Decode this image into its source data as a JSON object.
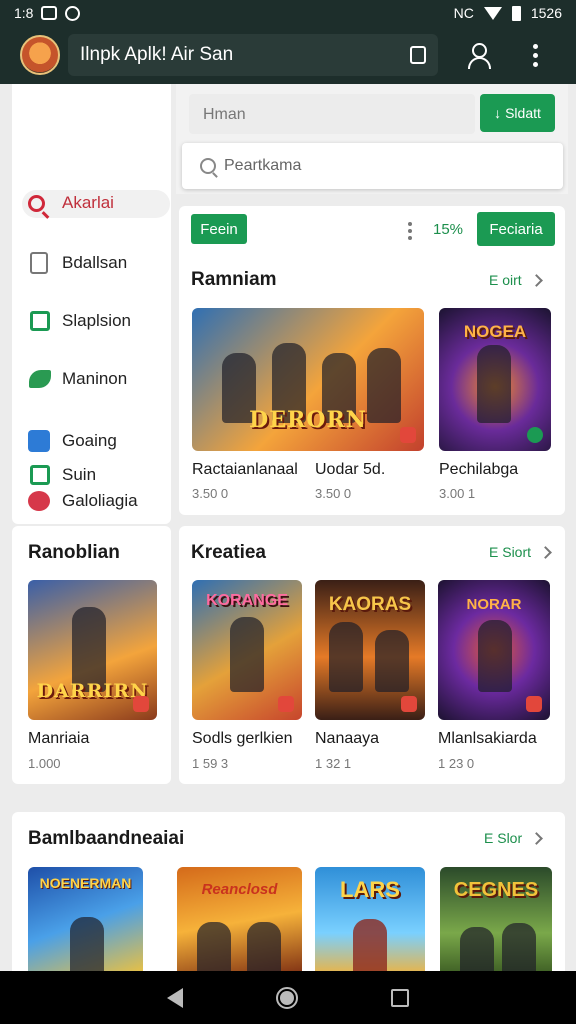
{
  "status_bar": {
    "time_left": "1:8",
    "time_right": "1526",
    "network": "NC"
  },
  "app_bar": {
    "title": "Ilnpk Aplk! Air San"
  },
  "sidebar": {
    "items": [
      {
        "label": "Akarlai",
        "icon": "search-icon",
        "active": true,
        "color": "#d0283a"
      },
      {
        "label": "Bdallsan",
        "icon": "document-icon",
        "color": "#777777"
      },
      {
        "label": "Slaplsion",
        "icon": "bag-icon",
        "color": "#1b9a53"
      },
      {
        "label": "Maninon",
        "icon": "leaf-icon",
        "color": "#2a9a52"
      },
      {
        "label": "Goaing",
        "icon": "check-icon",
        "color": "#2d7bd6"
      },
      {
        "label": "Galoliagia",
        "icon": "tag-icon",
        "color": "#d6384a"
      },
      {
        "label": "Suin",
        "icon": "play-icon",
        "color": "#1b9a53"
      }
    ]
  },
  "search": {
    "placeholder": "Hman",
    "filter_label": "Sldatt",
    "suggestion": "Peartkama"
  },
  "featured": {
    "chip": "Feein",
    "percent": "15%",
    "button": "Feciaria",
    "title": "Ramniam",
    "see_all": "E oirt",
    "cards": [
      {
        "name": "Ractaianlanaal",
        "price": "3.50 0",
        "banner": "DERORN",
        "colors": [
          "#2f6fb3",
          "#f4a43b",
          "#c2402d"
        ]
      },
      {
        "name": "Uodar 5d.",
        "price": "3.50 0",
        "banner": "",
        "colors": [
          "#3a2b63",
          "#f0a23a",
          "#c43b2b"
        ]
      },
      {
        "name": "Pechilabga",
        "price": "3.00 1",
        "banner": "NOGEA",
        "colors": [
          "#1b1330",
          "#6a2b9a",
          "#f28a2a"
        ]
      }
    ]
  },
  "side_feature": {
    "title": "Ranoblian",
    "name": "Manriaia",
    "price": "1.000",
    "banner": "DARRIRN"
  },
  "kreatiea": {
    "title": "Kreatiea",
    "see_all": "E Siort",
    "cards": [
      {
        "name": "Sodls gerlkien",
        "price": "1 59 3",
        "banner": "KORANGE",
        "colors": [
          "#2f6fb3",
          "#e4a13a",
          "#c7452c"
        ]
      },
      {
        "name": "Nanaaya",
        "price": "1 32 1",
        "banner": "KAORAS",
        "colors": [
          "#3a1f16",
          "#e57a27",
          "#f7c64a"
        ]
      },
      {
        "name": "Mlanlsakiarda",
        "price": "1 23 0",
        "banner": "NORAR",
        "colors": [
          "#1c1230",
          "#6c2aa0",
          "#e25a3a"
        ]
      }
    ]
  },
  "bottom_section": {
    "title": "Bamlbaandneaiai",
    "see_all": "E Slor",
    "cards": [
      {
        "banner": "NOENERMAN",
        "colors": [
          "#1e4fa8",
          "#4aa0e8",
          "#f2c23a"
        ]
      },
      {
        "banner": "Reanclosd",
        "colors": [
          "#d46a1a",
          "#f6b23a",
          "#7a2b12"
        ]
      },
      {
        "banner": "LARS",
        "colors": [
          "#2f8fd8",
          "#7ad0ff",
          "#f2b23a"
        ]
      },
      {
        "banner": "CEGNES",
        "colors": [
          "#2b4a2a",
          "#7aa84a",
          "#f2c23a"
        ]
      }
    ]
  }
}
